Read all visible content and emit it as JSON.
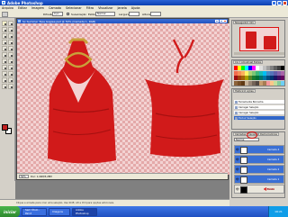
{
  "window": {
    "title": "Adobe Photoshop"
  },
  "menu": [
    "Arquivo",
    "Editar",
    "Imagem",
    "Camada",
    "Selecionar",
    "Filtro",
    "Visualizar",
    "Janela",
    "Ajuda"
  ],
  "options": {
    "feather_label": "Difusão:",
    "feather_value": "0 px",
    "antialias_label": "Suavização",
    "style_label": "Estilo:",
    "style_value": "Normal",
    "width_label": "Largura:",
    "height_label": "Altura:"
  },
  "document": {
    "title": "Sx Summer Tops Gagiee.psd @ 50% (Camada 1, RGB)",
    "zoom": "50%",
    "status": "Doc: 1,44M/3,28M"
  },
  "statusbar": {
    "text": "Clique e arraste para criar uma seleção. Use Shift, Alt e Ctrl para opções adicionais."
  },
  "panels": {
    "navigator": {
      "tabs": [
        "Navegador",
        "Info"
      ]
    },
    "swatches": {
      "tabs": [
        "Cor",
        "Amostras",
        "Estilos"
      ]
    },
    "history": {
      "tabs": [
        "Histórico",
        "Ações"
      ],
      "items": [
        "Ferramenta Borracha",
        "Carregar Seleção",
        "Carregar Seleção",
        "Excluir Seleção"
      ]
    },
    "layers": {
      "tabs": [
        "Camadas",
        "Canais",
        "Demarcadores"
      ],
      "mode": "Normal",
      "rows": [
        {
          "name": "Camada 4",
          "style": "blue",
          "thumb": "white"
        },
        {
          "name": "Camada 3",
          "style": "blue",
          "thumb": "white"
        },
        {
          "name": "Camada 2",
          "style": "blue",
          "thumb": "white"
        },
        {
          "name": "Camada 1",
          "style": "blue",
          "thumb": "white"
        },
        {
          "name": "Fundo",
          "style": "grey",
          "thumb": "dark"
        }
      ]
    }
  },
  "colors": {
    "accent_red": "#d11a1a",
    "selection_blue": "#3a6fd4",
    "taskbar": "#2a5fd6"
  },
  "taskbar": {
    "start": "iniciar",
    "tasks": [
      "Sem título - Paint",
      "Imagens",
      "Adobe Photoshop"
    ],
    "clock": "16:21"
  }
}
